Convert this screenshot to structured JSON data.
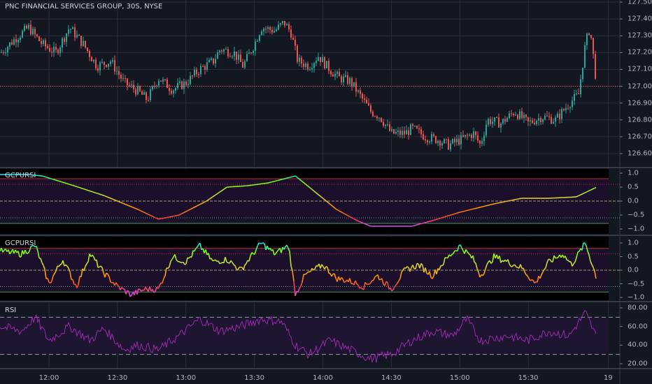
{
  "header": {
    "symbol_title": "PNC FINANCIAL SERVICES GROUP, 30S, NYSE"
  },
  "colors": {
    "background": "#131722",
    "up": "#26a69a",
    "down": "#ef5350",
    "grid": "#2a2e39",
    "rsi_line": "#9c27b0",
    "osc_band": "#1c0f2c"
  },
  "time_axis": {
    "labels": [
      {
        "label": "12:00",
        "m": 21
      },
      {
        "label": "12:30",
        "m": 51
      },
      {
        "label": "13:00",
        "m": 81
      },
      {
        "label": "13:30",
        "m": 111
      },
      {
        "label": "14:00",
        "m": 141
      },
      {
        "label": "14:30",
        "m": 171
      },
      {
        "label": "15:00",
        "m": 201
      },
      {
        "label": "15:30",
        "m": 231
      },
      {
        "label": "19",
        "m": 266
      }
    ]
  },
  "chart_data": [
    {
      "type": "candlestick",
      "title": "PNC FINANCIAL SERVICES GROUP, 30S, NYSE",
      "y_ticks": [
        "127.50",
        "127.40",
        "127.30",
        "127.20",
        "127.10",
        "127.00",
        "126.90",
        "126.80",
        "126.70",
        "126.60"
      ],
      "ylim": [
        126.55,
        127.52
      ],
      "last_price_line": 127.0,
      "close_anchors": [
        [
          0,
          127.2
        ],
        [
          6,
          127.28
        ],
        [
          12,
          127.35
        ],
        [
          18,
          127.25
        ],
        [
          24,
          127.2
        ],
        [
          30,
          127.35
        ],
        [
          36,
          127.25
        ],
        [
          42,
          127.12
        ],
        [
          48,
          127.15
        ],
        [
          54,
          127.02
        ],
        [
          60,
          126.97
        ],
        [
          64,
          126.92
        ],
        [
          69,
          127.05
        ],
        [
          75,
          126.98
        ],
        [
          81,
          127.02
        ],
        [
          87,
          127.1
        ],
        [
          93,
          127.15
        ],
        [
          96,
          127.22
        ],
        [
          102,
          127.2
        ],
        [
          106,
          127.12
        ],
        [
          111,
          127.25
        ],
        [
          114,
          127.35
        ],
        [
          120,
          127.33
        ],
        [
          124,
          127.38
        ],
        [
          127,
          127.32
        ],
        [
          130,
          127.15
        ],
        [
          135,
          127.12
        ],
        [
          139,
          127.18
        ],
        [
          144,
          127.1
        ],
        [
          148,
          127.05
        ],
        [
          153,
          127.03
        ],
        [
          157,
          126.95
        ],
        [
          162,
          126.85
        ],
        [
          166,
          126.82
        ],
        [
          171,
          126.72
        ],
        [
          177,
          126.72
        ],
        [
          180,
          126.75
        ],
        [
          186,
          126.7
        ],
        [
          192,
          126.68
        ],
        [
          196,
          126.65
        ],
        [
          201,
          126.68
        ],
        [
          207,
          126.72
        ],
        [
          210,
          126.65
        ],
        [
          213,
          126.8
        ],
        [
          219,
          126.78
        ],
        [
          225,
          126.85
        ],
        [
          231,
          126.78
        ],
        [
          237,
          126.82
        ],
        [
          243,
          126.8
        ],
        [
          249,
          126.9
        ],
        [
          253,
          126.95
        ],
        [
          256,
          127.25
        ],
        [
          258,
          127.35
        ],
        [
          261,
          127.0
        ]
      ]
    },
    {
      "type": "line",
      "name": "GCPURSI",
      "smooth": true,
      "y_ticks": [
        "1.0",
        "0.5",
        "0.0",
        "−0.5",
        "−1.0"
      ],
      "ylim": [
        -1.2,
        1.2
      ],
      "levels": {
        "upper": 0.8,
        "upper_dotted": 0.6,
        "mid": 0.0,
        "lower_dotted": -0.6,
        "lower": -0.8
      },
      "anchors": [
        [
          0,
          0.95
        ],
        [
          12,
          0.95
        ],
        [
          18,
          0.9
        ],
        [
          30,
          0.6
        ],
        [
          45,
          0.2
        ],
        [
          60,
          -0.3
        ],
        [
          69,
          -0.65
        ],
        [
          78,
          -0.5
        ],
        [
          90,
          0.0
        ],
        [
          99,
          0.5
        ],
        [
          108,
          0.55
        ],
        [
          117,
          0.65
        ],
        [
          129,
          0.9
        ],
        [
          138,
          0.3
        ],
        [
          147,
          -0.3
        ],
        [
          156,
          -0.7
        ],
        [
          162,
          -0.9
        ],
        [
          180,
          -0.9
        ],
        [
          189,
          -0.7
        ],
        [
          201,
          -0.4
        ],
        [
          216,
          -0.1
        ],
        [
          228,
          0.1
        ],
        [
          240,
          0.1
        ],
        [
          252,
          0.15
        ],
        [
          261,
          0.5
        ]
      ]
    },
    {
      "type": "line",
      "name": "GCPURSI",
      "smooth": false,
      "y_ticks": [
        "1.0",
        "0.5",
        "0.0",
        "−0.5",
        "−1.0"
      ],
      "ylim": [
        -1.2,
        1.2
      ],
      "levels": {
        "upper": 0.8,
        "upper_dotted": 0.6,
        "mid": 0.0,
        "lower_dotted": -0.6,
        "lower": -0.8
      },
      "anchors": [
        [
          0,
          0.7
        ],
        [
          9,
          0.6
        ],
        [
          15,
          0.9
        ],
        [
          21,
          -0.5
        ],
        [
          27,
          0.4
        ],
        [
          33,
          -0.6
        ],
        [
          39,
          0.6
        ],
        [
          45,
          -0.1
        ],
        [
          51,
          -0.6
        ],
        [
          57,
          -0.9
        ],
        [
          63,
          -0.7
        ],
        [
          69,
          -0.7
        ],
        [
          75,
          0.5
        ],
        [
          81,
          0.3
        ],
        [
          87,
          0.9
        ],
        [
          93,
          0.3
        ],
        [
          99,
          0.4
        ],
        [
          105,
          0.0
        ],
        [
          114,
          1.0
        ],
        [
          120,
          0.6
        ],
        [
          126,
          0.9
        ],
        [
          129,
          -0.9
        ],
        [
          133,
          -0.2
        ],
        [
          141,
          0.2
        ],
        [
          147,
          -0.3
        ],
        [
          153,
          -0.4
        ],
        [
          159,
          -0.6
        ],
        [
          165,
          -0.2
        ],
        [
          171,
          -0.7
        ],
        [
          177,
          0.0
        ],
        [
          183,
          0.2
        ],
        [
          189,
          -0.2
        ],
        [
          195,
          0.4
        ],
        [
          201,
          0.9
        ],
        [
          207,
          0.4
        ],
        [
          210,
          -0.2
        ],
        [
          216,
          0.5
        ],
        [
          222,
          0.3
        ],
        [
          228,
          0.1
        ],
        [
          234,
          -0.5
        ],
        [
          240,
          0.3
        ],
        [
          246,
          0.6
        ],
        [
          250,
          0.2
        ],
        [
          256,
          1.0
        ],
        [
          261,
          -0.3
        ]
      ]
    },
    {
      "type": "line",
      "name": "RSI",
      "y_ticks": [
        "80.00",
        "60.00",
        "40.00",
        "20.00"
      ],
      "ylim": [
        15,
        83
      ],
      "levels": {
        "upper": 70,
        "lower": 30
      },
      "anchors": [
        [
          0,
          60
        ],
        [
          9,
          55
        ],
        [
          15,
          70
        ],
        [
          21,
          45
        ],
        [
          30,
          60
        ],
        [
          39,
          45
        ],
        [
          45,
          58
        ],
        [
          54,
          35
        ],
        [
          60,
          40
        ],
        [
          69,
          35
        ],
        [
          78,
          50
        ],
        [
          87,
          68
        ],
        [
          96,
          55
        ],
        [
          105,
          60
        ],
        [
          114,
          68
        ],
        [
          123,
          65
        ],
        [
          129,
          40
        ],
        [
          135,
          30
        ],
        [
          144,
          45
        ],
        [
          153,
          35
        ],
        [
          162,
          25
        ],
        [
          171,
          30
        ],
        [
          180,
          45
        ],
        [
          189,
          55
        ],
        [
          198,
          50
        ],
        [
          204,
          68
        ],
        [
          210,
          45
        ],
        [
          222,
          50
        ],
        [
          231,
          45
        ],
        [
          240,
          55
        ],
        [
          249,
          50
        ],
        [
          256,
          75
        ],
        [
          261,
          48
        ]
      ]
    }
  ]
}
